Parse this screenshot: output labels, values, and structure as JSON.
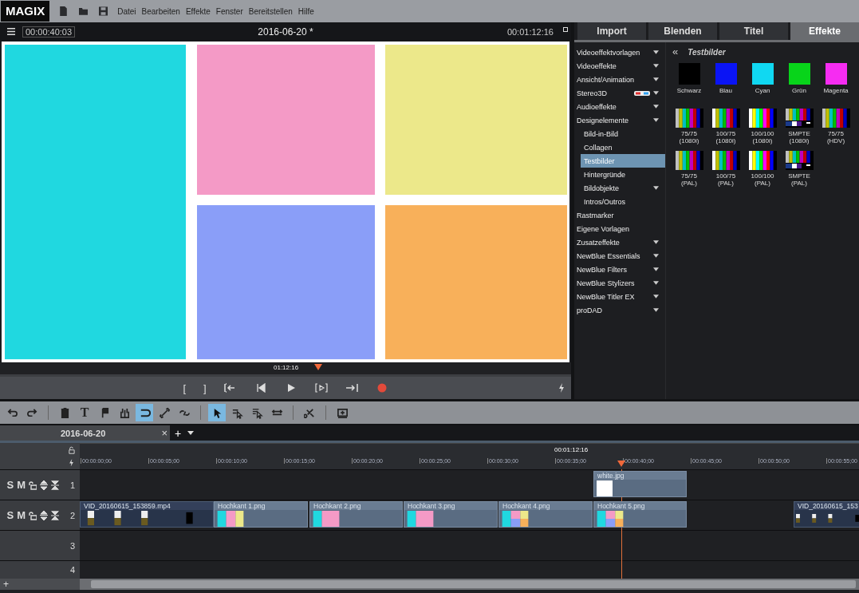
{
  "app": {
    "logo": "MAGIX",
    "menu": [
      "Datei",
      "Bearbeiten",
      "Effekte",
      "Fenster",
      "Bereitstellen",
      "Hilfe"
    ]
  },
  "preview": {
    "position": "00:00:40:03",
    "title": "2016-06-20 *",
    "duration": "00:01:12:16",
    "scrub_time": "01:12:16",
    "scrub": {
      "level": 0.55
    }
  },
  "transport": [
    {
      "kind": "mark-in",
      "label": "["
    },
    {
      "kind": "mark-out",
      "label": "]"
    },
    {
      "kind": "go-start"
    },
    {
      "kind": "prev"
    },
    {
      "kind": "play"
    },
    {
      "kind": "next-marker"
    },
    {
      "kind": "go-end"
    },
    {
      "kind": "record"
    }
  ],
  "tabs": [
    {
      "label": "Import",
      "selected": false
    },
    {
      "label": "Blenden",
      "selected": false
    },
    {
      "label": "Titel",
      "selected": false
    },
    {
      "label": "Effekte",
      "selected": true
    }
  ],
  "effects_menu": [
    {
      "label": "Videoeffektvorlagen",
      "submenu": true,
      "selected": false
    },
    {
      "label": "Videoeffekte",
      "submenu": true,
      "selected": false
    },
    {
      "label": "Ansicht/Animation",
      "submenu": true,
      "selected": false
    },
    {
      "label": "Stereo3D",
      "submenu": true,
      "kind": "stereo",
      "selected": false
    },
    {
      "label": "Audioeffekte",
      "submenu": true,
      "selected": false
    },
    {
      "label": "Designelemente",
      "submenu": true,
      "selected": false,
      "children": [
        {
          "label": "Bild-in-Bild",
          "submenu": false,
          "selected": false
        },
        {
          "label": "Collagen",
          "submenu": false,
          "selected": false
        },
        {
          "label": "Testbilder",
          "submenu": false,
          "selected": true
        },
        {
          "label": "Hintergründe",
          "submenu": false,
          "selected": false
        },
        {
          "label": "Bildobjekte",
          "submenu": true,
          "selected": false
        },
        {
          "label": "Intros/Outros",
          "submenu": false,
          "selected": false
        }
      ]
    },
    {
      "label": "Rastmarker",
      "submenu": false,
      "selected": false
    },
    {
      "label": "Eigene Vorlagen",
      "submenu": false,
      "selected": false
    },
    {
      "label": "Zusatzeffekte",
      "submenu": true,
      "selected": false
    },
    {
      "label": "NewBlue Essentials",
      "submenu": true,
      "selected": false
    },
    {
      "label": "NewBlue Filters",
      "submenu": true,
      "selected": false
    },
    {
      "label": "NewBlue Stylizers",
      "submenu": true,
      "selected": false
    },
    {
      "label": "NewBlue Titler EX",
      "submenu": true,
      "selected": false
    },
    {
      "label": "proDAD",
      "submenu": true,
      "selected": false
    }
  ],
  "browser": {
    "back": "«",
    "title": "Testbilder",
    "swatches": [
      {
        "label": "Schwarz",
        "color": "#000000"
      },
      {
        "label": "Blau",
        "color": "#0a14f5"
      },
      {
        "label": "Cyan",
        "color": "#10d8f2"
      },
      {
        "label": "Grün",
        "color": "#08d41a"
      },
      {
        "label": "Magenta",
        "color": "#f62cf2"
      }
    ],
    "patterns": [
      {
        "label": "75/75",
        "format": "(1080i)",
        "kind": "bars75"
      },
      {
        "label": "100/75",
        "format": "(1080i)",
        "kind": "bars100"
      },
      {
        "label": "100/100",
        "format": "(1080i)",
        "kind": "bars100full"
      },
      {
        "label": "SMPTE",
        "format": "(1080i)",
        "kind": "smpte"
      },
      {
        "label": "75/75",
        "format": "(HDV)",
        "kind": "bars75"
      },
      {
        "label": "75/75",
        "format": "(PAL)",
        "kind": "bars75"
      },
      {
        "label": "100/75",
        "format": "(PAL)",
        "kind": "bars100"
      },
      {
        "label": "100/100",
        "format": "(PAL)",
        "kind": "bars100full"
      },
      {
        "label": "SMPTE",
        "format": "(PAL)",
        "kind": "smpte"
      }
    ]
  },
  "toolbar": [
    {
      "kind": "undo",
      "selected": false
    },
    {
      "kind": "redo",
      "selected": false
    },
    {
      "kind": "sep"
    },
    {
      "kind": "delete",
      "selected": false
    },
    {
      "kind": "text",
      "label": "T",
      "selected": false
    },
    {
      "kind": "marker",
      "selected": false
    },
    {
      "kind": "split",
      "selected": false
    },
    {
      "kind": "snap",
      "selected": true
    },
    {
      "kind": "link",
      "selected": false
    },
    {
      "kind": "unlink",
      "selected": false
    },
    {
      "kind": "sep"
    },
    {
      "kind": "pointer",
      "selected": true
    },
    {
      "kind": "select-track",
      "selected": false
    },
    {
      "kind": "select-all",
      "selected": false
    },
    {
      "kind": "stretch",
      "selected": false
    },
    {
      "kind": "sep"
    },
    {
      "kind": "cut",
      "selected": false
    },
    {
      "kind": "sep"
    },
    {
      "kind": "insert",
      "selected": false
    }
  ],
  "timeline": {
    "tab": "2016-06-20",
    "close": "×",
    "add": "+",
    "end_marker": "00:01:12:16",
    "playhead": {
      "level": 0.695
    },
    "ruler": [
      "00:00:00;00",
      "00:00:05;00",
      "00:00:10;00",
      "00:00:15;00",
      "00:00:20;00",
      "00:00:25;00",
      "00:00:30;00",
      "00:00:35;00",
      "00:00:40;00",
      "00:00:45;00",
      "00:00:50;00",
      "00:00:55;00"
    ],
    "tracks": [
      {
        "number": "1",
        "solo": "S",
        "mute": "M",
        "clips": [
          {
            "name": "white.jpg",
            "kind": "white"
          }
        ]
      },
      {
        "number": "2",
        "solo": "S",
        "mute": "M",
        "clips": [
          {
            "name": "VID_20160615_153859.mp4",
            "kind": "video"
          },
          {
            "name": "Hochkant 1.png",
            "kind": "collage-a"
          },
          {
            "name": "Hochkant 2.png",
            "kind": "collage-b"
          },
          {
            "name": "Hochkant 3.png",
            "kind": "collage-b"
          },
          {
            "name": "Hochkant 4.png",
            "kind": "collage-c"
          },
          {
            "name": "Hochkant 5.png",
            "kind": "collage-c"
          },
          {
            "name": "VID_20160615_153",
            "kind": "video"
          }
        ]
      },
      {
        "number": "3"
      },
      {
        "number": "4"
      }
    ],
    "add_track": "+"
  }
}
